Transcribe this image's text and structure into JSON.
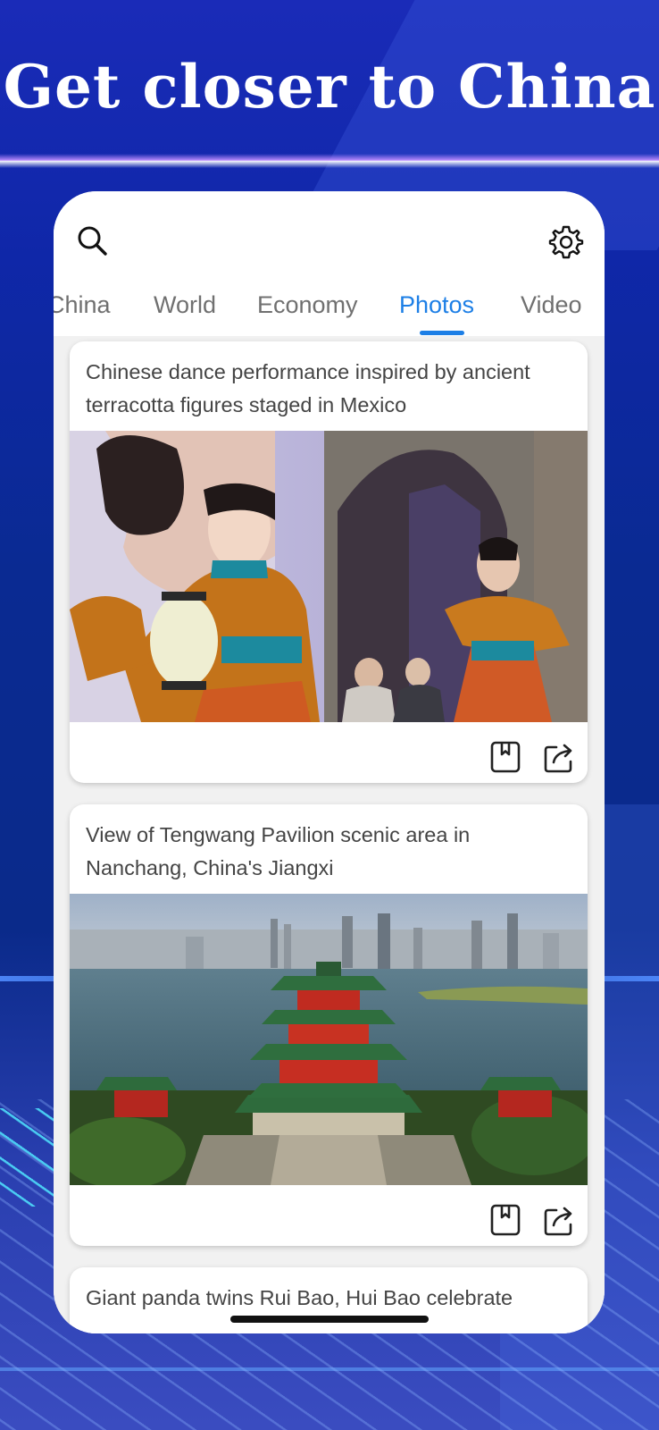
{
  "hero": {
    "headline": "Get closer to China"
  },
  "header": {
    "search_icon": "search-icon",
    "settings_icon": "gear-icon"
  },
  "tabs": [
    {
      "label": "China",
      "active": false
    },
    {
      "label": "World",
      "active": false
    },
    {
      "label": "Economy",
      "active": false
    },
    {
      "label": "Photos",
      "active": true
    },
    {
      "label": "Video",
      "active": false
    }
  ],
  "colors": {
    "accent": "#1d7fe6",
    "text": "#444444",
    "tab_inactive": "#707070"
  },
  "feed": {
    "items": [
      {
        "title": "Chinese dance performance inspired by ancient terracotta figures staged in Mexico",
        "image": "dance performers in orange costumes with lanterns",
        "actions": [
          "bookmark-icon",
          "share-icon"
        ]
      },
      {
        "title": "View of Tengwang Pavilion scenic area in Nanchang, China's Jiangxi",
        "image": "aerial view of Tengwang Pavilion by the river with city skyline",
        "actions": [
          "bookmark-icon",
          "share-icon"
        ]
      },
      {
        "title": "Giant panda twins Rui Bao, Hui Bao celebrate"
      }
    ]
  }
}
